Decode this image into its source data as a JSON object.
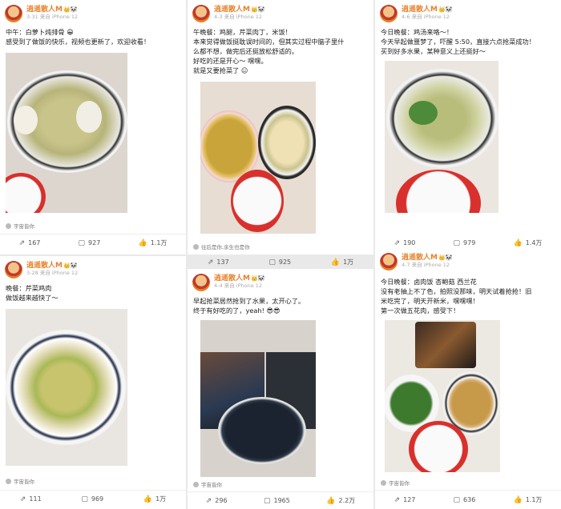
{
  "posts": [
    {
      "user": "逍遥散人M",
      "date": "3-31",
      "device": "来自 iPhone 12",
      "lines": [
        "中午：白萝卜炖排骨 😀",
        "感受到了做饭的快乐，视频也更新了，欢迎收看！"
      ],
      "source": "宇宙皆你",
      "repost": "167",
      "comments": "927",
      "likes": "1.1万"
    },
    {
      "user": "逍遥散人M",
      "date": "4-3",
      "device": "来自 iPhone 12",
      "lines": [
        "午晚餐：鸡腿，芹菜肉丁，米饭！",
        "本来觉得做饭挺耽误时间的，但其实过程中脑子里什",
        "么都不想，做完后还挺放松舒适的。",
        "好吃的还是开心～ 嘿嘿。",
        "就是又要抢菜了 😑"
      ],
      "source": "往后是你,余生也是你",
      "repost": "137",
      "comments": "925",
      "likes": "1万"
    },
    {
      "user": "逍遥散人M",
      "date": "4-6",
      "device": "来自 iPhone 12",
      "lines": [
        "今日晚餐：鸡汤来咯～！",
        "今天早起做噩梦了，吓醒 5:50，直接六点抢菜成功！",
        "买到好多水果，某种意义上还挺好～"
      ],
      "source": "",
      "repost": "190",
      "comments": "979",
      "likes": "1.4万"
    },
    {
      "user": "逍遥散人M",
      "date": "3-28",
      "device": "来自 iPhone 12",
      "lines": [
        "晚餐：芹菜鸡肉",
        "做饭越来越快了～"
      ],
      "source": "宇宙皆你",
      "repost": "111",
      "comments": "969",
      "likes": "1万"
    },
    {
      "user": "逍遥散人M",
      "date": "4-4",
      "device": "来自 iPhone 12",
      "lines": [
        "早起抢菜居然抢到了水果，太开心了。",
        "终于有好吃的了，yeah! 😎😎"
      ],
      "source": "宇宙皆你",
      "repost": "296",
      "comments": "1965",
      "likes": "2.2万"
    },
    {
      "user": "逍遥散人M",
      "date": "4-7",
      "device": "来自 iPhone 12",
      "lines": [
        "今日晚餐：卤肉饭 杏鲍菇 西兰花",
        "没有老抽上不了色，拍照没那味，明天试着抢抢！旧",
        "米吃完了，明天开新米，嘿嘿嘿！",
        "第一次做五花肉，感受下！"
      ],
      "source": "宇宙皆你",
      "repost": "127",
      "comments": "636",
      "likes": "1.1万"
    }
  ],
  "icons": {
    "repost": "share-icon",
    "comment": "comment-icon",
    "like": "thumbs-up-icon"
  }
}
